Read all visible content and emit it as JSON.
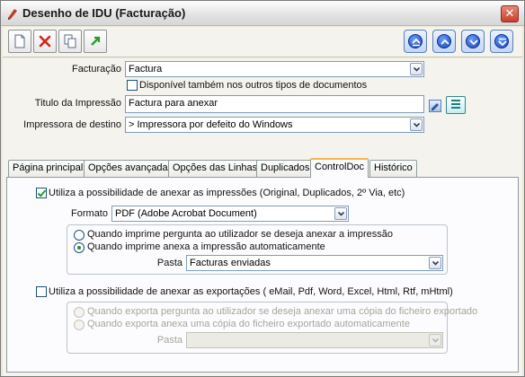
{
  "window": {
    "title": "Desenho de IDU (Facturação)",
    "close_label": "✕"
  },
  "toolbar": {
    "buttons": [
      "new-document-icon",
      "delete-icon",
      "copy-icon",
      "export-icon"
    ],
    "nav": [
      "first-record-icon",
      "previous-record-icon",
      "next-record-icon",
      "last-record-icon"
    ]
  },
  "form": {
    "facturacao_label": "Facturação",
    "facturacao_value": "Factura",
    "disponivel_label": "Disponível também nos outros tipos de documentos",
    "disponivel_checked": false,
    "titulo_label": "Titulo da Impressão",
    "titulo_value": "Factura para anexar",
    "impressora_label": "Impressora de destino",
    "impressora_value": "> Impressora por defeito do Windows"
  },
  "tabs": [
    {
      "label": "Página principal",
      "active": false
    },
    {
      "label": "Opções avançadas",
      "active": false
    },
    {
      "label": "Opções das Linhas",
      "active": false
    },
    {
      "label": "Duplicados",
      "active": false
    },
    {
      "label": "ControlDoc",
      "active": true
    },
    {
      "label": "Histórico",
      "active": false
    }
  ],
  "controldoc": {
    "anexar_impressoes_label": "Utiliza a possibilidade de anexar as impressões (Original, Duplicados, 2º Via, etc)",
    "anexar_impressoes_checked": true,
    "formato_label": "Formato",
    "formato_value": "PDF (Adobe Acrobat Document)",
    "imp_opt1_label": "Quando imprime pergunta ao utilizador se deseja anexar a impressão",
    "imp_opt2_label": "Quando imprime anexa a impressão automaticamente",
    "imp_selected": 2,
    "pasta_label": "Pasta",
    "pasta_value": "Facturas enviadas",
    "anexar_exportacoes_label": "Utiliza a possibilidade de anexar as exportações ( eMail, Pdf, Word, Excel, Html, Rtf, mHtml)",
    "anexar_exportacoes_checked": false,
    "exp_opt1_label": "Quando exporta pergunta ao utilizador se deseja anexar uma cópia do ficheiro exportado",
    "exp_opt2_label": "Quando exporta anexa uma cópia do ficheiro exportado automaticamente",
    "exp_pasta_label": "Pasta",
    "exp_pasta_value": ""
  }
}
